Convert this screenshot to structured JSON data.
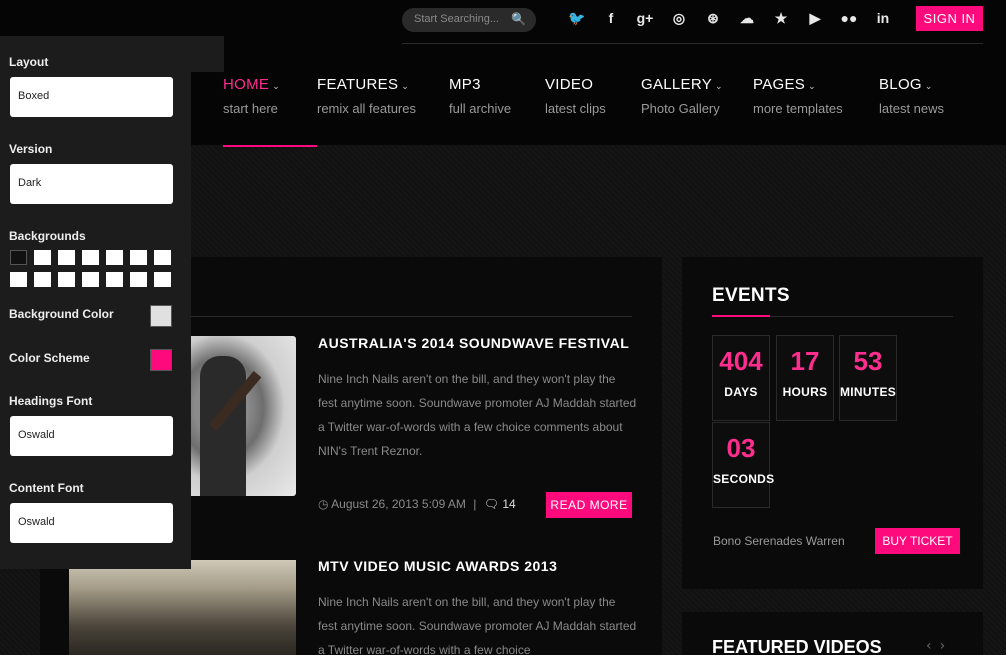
{
  "header": {
    "search_placeholder": "Start Searching...",
    "social_icons": [
      "twitter-icon",
      "facebook-icon",
      "google-plus-icon",
      "instagram-icon",
      "dribbble-icon",
      "cloud-icon",
      "star-icon",
      "youtube-icon",
      "flickr-icon",
      "linkedin-icon"
    ],
    "social_glyphs": [
      "🐦",
      "f",
      "g+",
      "◎",
      "⊛",
      "☁",
      "★",
      "▶",
      "●●",
      "in"
    ],
    "signin_label": "SIGN IN"
  },
  "nav": {
    "items": [
      {
        "title": "HOME",
        "sub": "start here",
        "chevron": true,
        "active": true
      },
      {
        "title": "FEATURES",
        "sub": "remix all features",
        "chevron": true
      },
      {
        "title": "MP3",
        "sub": "full archive",
        "chevron": false
      },
      {
        "title": "VIDEO",
        "sub": "latest clips",
        "chevron": false
      },
      {
        "title": "GALLERY",
        "sub": "Photo Gallery",
        "chevron": true
      },
      {
        "title": "PAGES",
        "sub": "more templates",
        "chevron": true
      },
      {
        "title": "BLOG",
        "sub": "latest news",
        "chevron": true
      }
    ]
  },
  "articles": [
    {
      "title": "AUSTRALIA'S 2014 SOUNDWAVE FESTIVAL",
      "excerpt": "Nine Inch Nails aren't on the bill, and they won't play the fest anytime soon. Soundwave promoter AJ Maddah started a Twitter war-of-words with a few choice comments about NIN's Trent Reznor.",
      "date": "August 26, 2013 5:09 AM",
      "comments": "14",
      "read_more": "READ MORE"
    },
    {
      "title": "MTV VIDEO MUSIC AWARDS 2013",
      "excerpt": "Nine Inch Nails aren't on the bill, and they won't play the fest anytime soon. Soundwave promoter AJ Maddah started a Twitter war-of-words with a few choice"
    }
  ],
  "events": {
    "title": "EVENTS",
    "countdown": [
      {
        "value": "404",
        "label": "DAYS"
      },
      {
        "value": "17",
        "label": "HOURS"
      },
      {
        "value": "53",
        "label": "MINUTES"
      },
      {
        "value": "03",
        "label": "SECONDS"
      }
    ],
    "event_name": "Bono Serenades Warren",
    "buy_ticket": "BUY TICKET"
  },
  "featured_videos": {
    "title": "FEATURED VIDEOS"
  },
  "switcher": {
    "layout_label": "Layout",
    "layout_value": "Boxed",
    "version_label": "Version",
    "version_value": "Dark",
    "backgrounds_label": "Backgrounds",
    "background_color_label": "Background Color",
    "background_color": "#e0e0e0",
    "color_scheme_label": "Color Scheme",
    "color_scheme": "#ff0a7c",
    "headings_font_label": "Headings Font",
    "headings_font_value": "Oswald",
    "content_font_label": "Content Font",
    "content_font_value": "Oswald"
  },
  "colors": {
    "accent": "#ff0a7c",
    "background": "#111111"
  }
}
